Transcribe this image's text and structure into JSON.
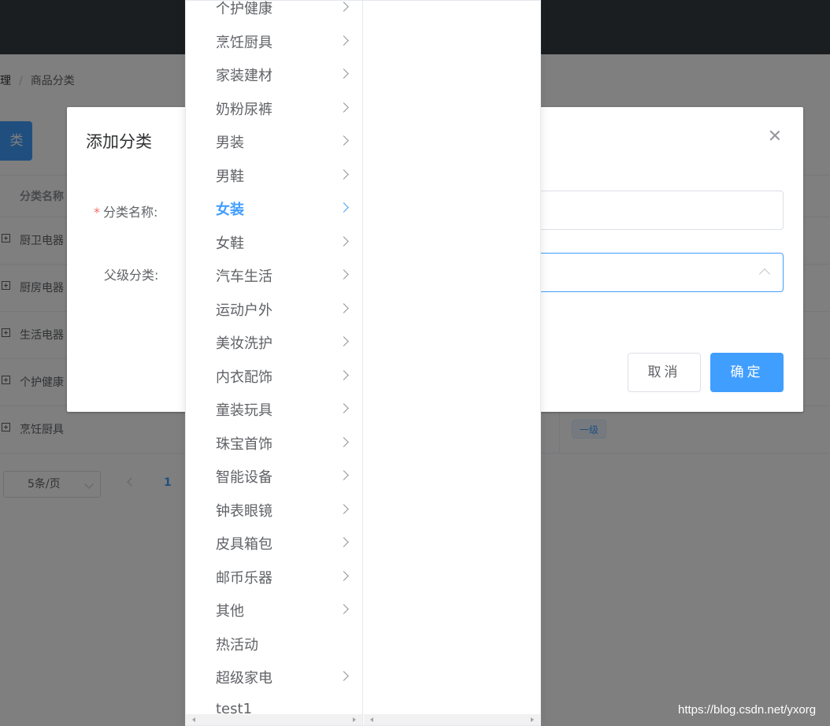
{
  "breadcrumb": {
    "items": [
      "理",
      "商品分类"
    ],
    "separator": "/"
  },
  "toolbar": {
    "add_label": "类"
  },
  "table": {
    "header": "分类名称",
    "rows": [
      "厨卫电器",
      "厨房电器",
      "生活电器",
      "个护健康",
      "烹饪厨具"
    ],
    "level_tag": "一级"
  },
  "pagination": {
    "page_size": "5条/页",
    "current_page": "1"
  },
  "dialog": {
    "title": "添加分类",
    "name_label": "分类名称:",
    "required_mark": "*",
    "parent_label": "父级分类:",
    "cancel_label": "取消",
    "ok_label": "确定"
  },
  "cascader": {
    "active_item": "女装",
    "items": [
      {
        "label": "个护健康",
        "has_children": true
      },
      {
        "label": "烹饪厨具",
        "has_children": true
      },
      {
        "label": "家装建材",
        "has_children": true
      },
      {
        "label": "奶粉尿裤",
        "has_children": true
      },
      {
        "label": "男装",
        "has_children": true
      },
      {
        "label": "男鞋",
        "has_children": true
      },
      {
        "label": "女装",
        "has_children": true
      },
      {
        "label": "女鞋",
        "has_children": true
      },
      {
        "label": "汽车生活",
        "has_children": true
      },
      {
        "label": "运动户外",
        "has_children": true
      },
      {
        "label": "美妆洗护",
        "has_children": true
      },
      {
        "label": "内衣配饰",
        "has_children": true
      },
      {
        "label": "童装玩具",
        "has_children": true
      },
      {
        "label": "珠宝首饰",
        "has_children": true
      },
      {
        "label": "智能设备",
        "has_children": true
      },
      {
        "label": "钟表眼镜",
        "has_children": true
      },
      {
        "label": "皮具箱包",
        "has_children": true
      },
      {
        "label": "邮币乐器",
        "has_children": true
      },
      {
        "label": "其他",
        "has_children": true
      },
      {
        "label": "热活动",
        "has_children": false
      },
      {
        "label": "超级家电",
        "has_children": true
      },
      {
        "label": "test1",
        "has_children": false
      }
    ]
  },
  "watermark": "https://blog.csdn.net/yxorg",
  "colors": {
    "primary": "#409eff",
    "danger": "#f56c6c",
    "topbar": "#373d41"
  }
}
